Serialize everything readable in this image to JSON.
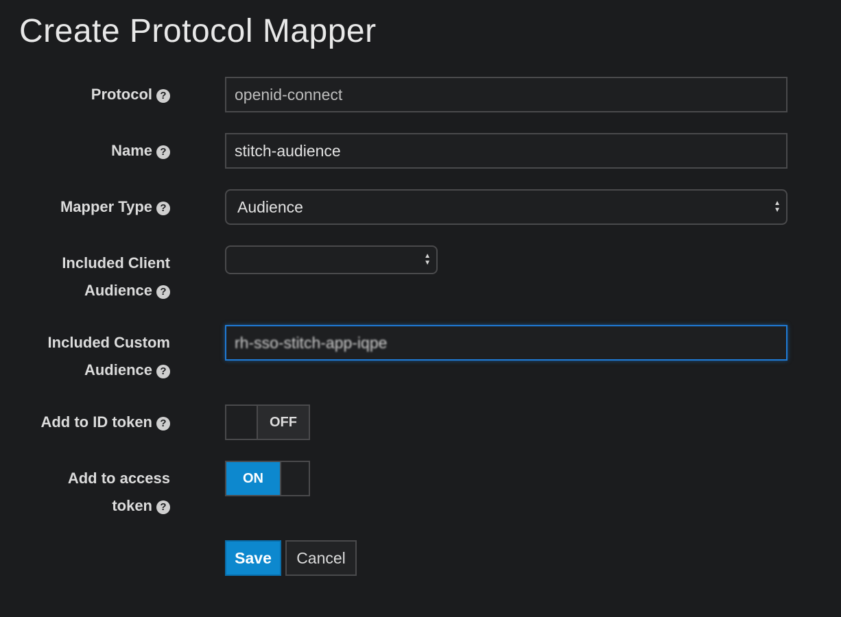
{
  "page": {
    "title": "Create Protocol Mapper"
  },
  "help_icon_glyph": "?",
  "form": {
    "protocol": {
      "label": "Protocol",
      "value": "openid-connect"
    },
    "name": {
      "label": "Name",
      "value": "stitch-audience"
    },
    "mapper_type": {
      "label": "Mapper Type",
      "selected": "Audience"
    },
    "included_client_audience": {
      "label_line1": "Included Client",
      "label_line2": "Audience",
      "selected": ""
    },
    "included_custom_audience": {
      "label_line1": "Included Custom",
      "label_line2": "Audience",
      "value": "rh-sso-stitch-app-iqpe"
    },
    "add_to_id_token": {
      "label": "Add to ID token",
      "state": "OFF"
    },
    "add_to_access_token": {
      "label_line1": "Add to access",
      "label_line2": "token",
      "state": "ON"
    }
  },
  "buttons": {
    "save": "Save",
    "cancel": "Cancel"
  },
  "colors": {
    "background": "#1b1c1e",
    "accent": "#0d88ce",
    "focus": "#1f7bd6"
  },
  "icons": {
    "help": "question-circle-icon",
    "select_arrows": "sort-arrows-icon"
  }
}
